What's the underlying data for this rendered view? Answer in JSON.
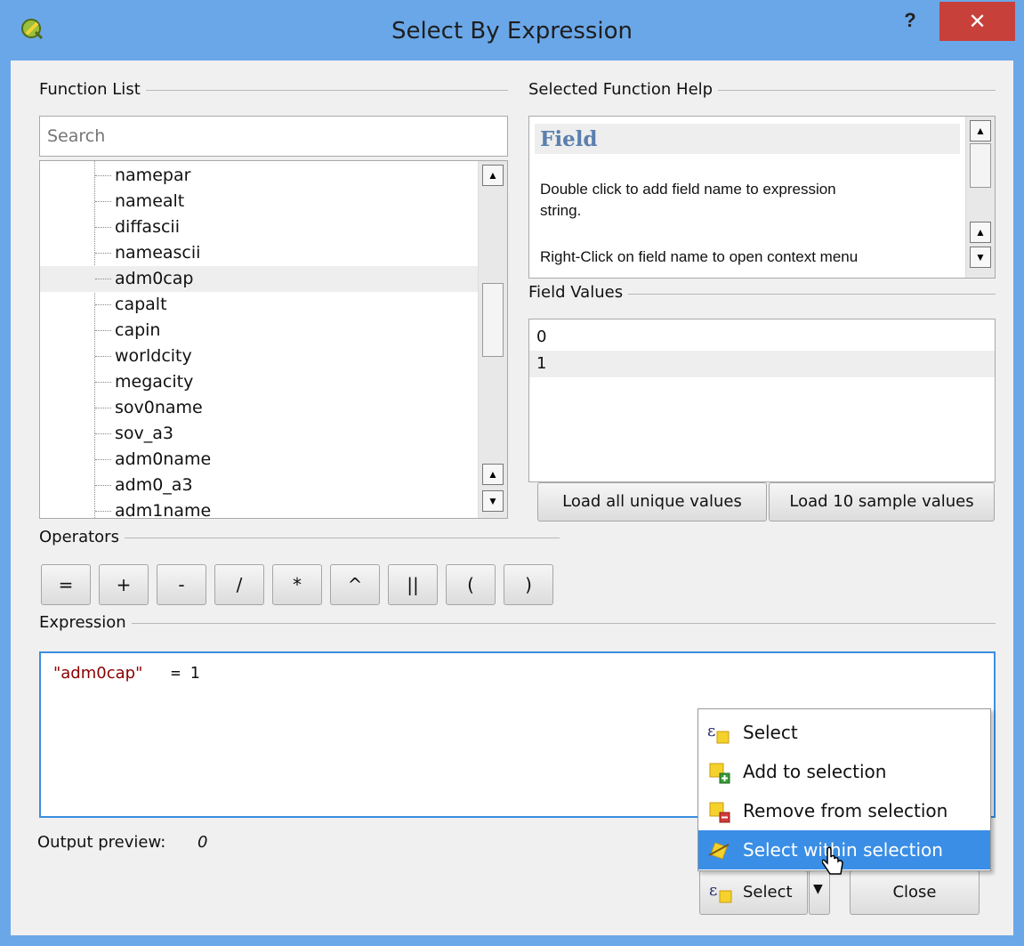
{
  "window": {
    "title": "Select By Expression",
    "help_label": "?",
    "close_label": "✕"
  },
  "function_list": {
    "label": "Function List",
    "search_placeholder": "Search",
    "items": [
      "namepar",
      "namealt",
      "diffascii",
      "nameascii",
      "adm0cap",
      "capalt",
      "capin",
      "worldcity",
      "megacity",
      "sov0name",
      "sov_a3",
      "adm0name",
      "adm0_a3",
      "adm1name"
    ],
    "selected": "adm0cap"
  },
  "help": {
    "label": "Selected Function Help",
    "title": "Field",
    "text1": "Double click to add field name to expression",
    "text1b": "string.",
    "text2": "Right-Click on field name to open context menu"
  },
  "field_values": {
    "label": "Field Values",
    "values": [
      "0",
      "1"
    ],
    "load_all_label": "Load all unique values",
    "load_sample_label": "Load 10 sample values"
  },
  "operators": {
    "label": "Operators",
    "buttons": [
      "=",
      "+",
      "-",
      "/",
      "*",
      "^",
      "||",
      "(",
      ")"
    ]
  },
  "expression": {
    "label": "Expression",
    "field": "\"adm0cap\"",
    "rest": " = 1"
  },
  "preview": {
    "label": "Output preview:",
    "value": "0"
  },
  "menu": {
    "items": [
      "Select",
      "Add to selection",
      "Remove from selection",
      "Select within selection"
    ],
    "highlighted": "Select within selection"
  },
  "footer": {
    "select_label": "Select",
    "close_label": "Close"
  },
  "colors": {
    "accent": "#3a8ee6",
    "title_bar": "#6aa7e8",
    "close": "#c7403a",
    "field_text": "#8b0000"
  },
  "icons": [
    "qgis-logo-icon",
    "expression-select-icon",
    "add-selection-icon",
    "remove-selection-icon",
    "select-within-icon",
    "mouse-cursor-icon"
  ]
}
